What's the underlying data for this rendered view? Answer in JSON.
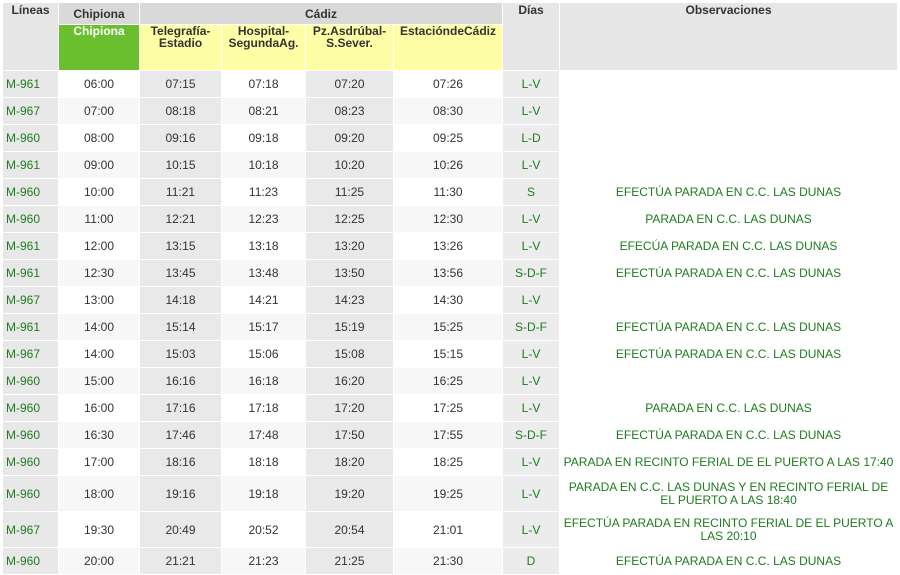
{
  "header": {
    "lineas": "Líneas",
    "origin_group": "Chipiona",
    "dest_group": "Cádiz",
    "dias": "Días",
    "observaciones": "Observaciones",
    "origin_stop": "Chipiona",
    "stops": [
      "Telegrafía-Estadio",
      "Hospital-SegundaAg.",
      "Pz.Asdrúbal-S.Sever.",
      "Estaciónde Cádiz"
    ],
    "stops_display": [
      [
        "Telegrafía-",
        "Estadio"
      ],
      [
        "Hospital-",
        "SegundaAg."
      ],
      [
        "Pz.Asdrúbal-",
        "S.Sever."
      ],
      [
        "EstacióndeCádiz",
        ""
      ]
    ]
  },
  "rows": [
    {
      "line": "M-961",
      "times": [
        "06:00",
        "07:15",
        "07:18",
        "07:20",
        "07:26"
      ],
      "days": "L-V",
      "obs": ""
    },
    {
      "line": "M-967",
      "times": [
        "07:00",
        "08:18",
        "08:21",
        "08:23",
        "08:30"
      ],
      "days": "L-V",
      "obs": ""
    },
    {
      "line": "M-960",
      "times": [
        "08:00",
        "09:16",
        "09:18",
        "09:20",
        "09:25"
      ],
      "days": "L-D",
      "obs": ""
    },
    {
      "line": "M-961",
      "times": [
        "09:00",
        "10:15",
        "10:18",
        "10:20",
        "10:26"
      ],
      "days": "L-V",
      "obs": ""
    },
    {
      "line": "M-960",
      "times": [
        "10:00",
        "11:21",
        "11:23",
        "11:25",
        "11:30"
      ],
      "days": "S",
      "obs": "EFECTÚA PARADA EN C.C. LAS DUNAS"
    },
    {
      "line": "M-960",
      "times": [
        "11:00",
        "12:21",
        "12:23",
        "12:25",
        "12:30"
      ],
      "days": "L-V",
      "obs": "PARADA EN C.C. LAS DUNAS"
    },
    {
      "line": "M-961",
      "times": [
        "12:00",
        "13:15",
        "13:18",
        "13:20",
        "13:26"
      ],
      "days": "L-V",
      "obs": "EFECÚA PARADA EN C.C. LAS DUNAS"
    },
    {
      "line": "M-961",
      "times": [
        "12:30",
        "13:45",
        "13:48",
        "13:50",
        "13:56"
      ],
      "days": "S-D-F",
      "obs": "EFECTÚA PARADA EN C.C. LAS DUNAS"
    },
    {
      "line": "M-967",
      "times": [
        "13:00",
        "14:18",
        "14:21",
        "14:23",
        "14:30"
      ],
      "days": "L-V",
      "obs": ""
    },
    {
      "line": "M-961",
      "times": [
        "14:00",
        "15:14",
        "15:17",
        "15:19",
        "15:25"
      ],
      "days": "S-D-F",
      "obs": "EFECTÚA PARADA EN C.C. LAS DUNAS"
    },
    {
      "line": "M-967",
      "times": [
        "14:00",
        "15:03",
        "15:06",
        "15:08",
        "15:15"
      ],
      "days": "L-V",
      "obs": "EFECTÚA PARADA EN C.C. LAS DUNAS"
    },
    {
      "line": "M-960",
      "times": [
        "15:00",
        "16:16",
        "16:18",
        "16:20",
        "16:25"
      ],
      "days": "L-V",
      "obs": ""
    },
    {
      "line": "M-960",
      "times": [
        "16:00",
        "17:16",
        "17:18",
        "17:20",
        "17:25"
      ],
      "days": "L-V",
      "obs": "PARADA EN C.C. LAS DUNAS"
    },
    {
      "line": "M-960",
      "times": [
        "16:30",
        "17:46",
        "17:48",
        "17:50",
        "17:55"
      ],
      "days": "S-D-F",
      "obs": "EFECTÚA PARADA EN C.C. LAS DUNAS"
    },
    {
      "line": "M-960",
      "times": [
        "17:00",
        "18:16",
        "18:18",
        "18:20",
        "18:25"
      ],
      "days": "L-V",
      "obs": "PARADA EN RECINTO FERIAL DE EL PUERTO A LAS 17:40"
    },
    {
      "line": "M-960",
      "times": [
        "18:00",
        "19:16",
        "19:18",
        "19:20",
        "19:25"
      ],
      "days": "L-V",
      "obs": "PARADA EN C.C. LAS DUNAS Y EN RECINTO FERIAL DE EL PUERTO A LAS 18:40"
    },
    {
      "line": "M-967",
      "times": [
        "19:30",
        "20:49",
        "20:52",
        "20:54",
        "21:01"
      ],
      "days": "L-V",
      "obs": "EFECTÚA PARADA EN RECINTO FERIAL DE EL PUERTO A LAS 20:10"
    },
    {
      "line": "M-960",
      "times": [
        "20:00",
        "21:21",
        "21:23",
        "21:25",
        "21:30"
      ],
      "days": "D",
      "obs": "EFECTÚA PARADA EN C.C. LAS DUNAS"
    }
  ],
  "colors": {
    "origin": "#6abf2e",
    "stop": "#fefea6",
    "green_text": "#1e7b1e"
  }
}
